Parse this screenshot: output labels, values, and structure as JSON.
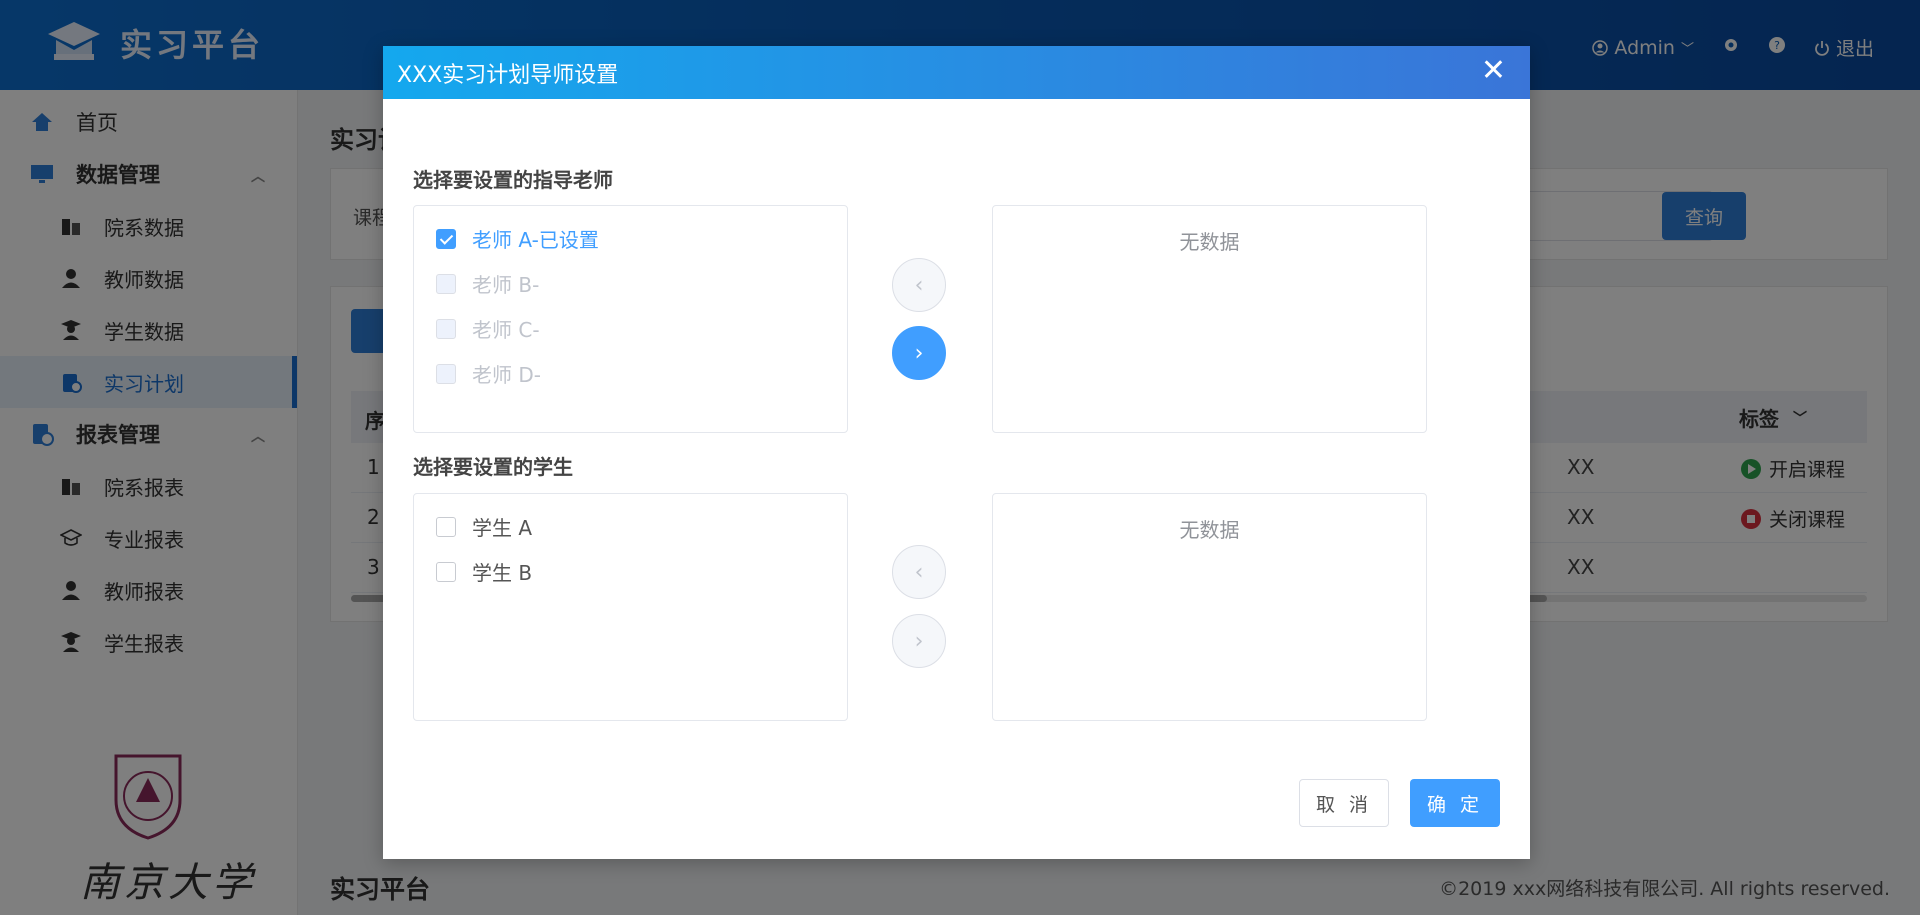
{
  "app": {
    "title": "实习平台"
  },
  "header": {
    "user": "Admin",
    "logout": "退出"
  },
  "sidebar": {
    "home": "首页",
    "groups": [
      {
        "label": "数据管理",
        "items": [
          "院系数据",
          "教师数据",
          "学生数据",
          "实习计划"
        ]
      },
      {
        "label": "报表管理",
        "items": [
          "院系报表",
          "专业报表",
          "教师报表",
          "学生报表"
        ]
      }
    ],
    "active_item": "实习计划",
    "calligraphy": "南京大学"
  },
  "main": {
    "page_title": "实习计",
    "filter_label": "课程",
    "query_button": "查询",
    "table": {
      "first_col_header": "序",
      "tag_header": "标签",
      "rows": [
        {
          "n": "1",
          "x": "XX",
          "tag": "开启课程",
          "status": "on"
        },
        {
          "n": "2",
          "x": "XX",
          "tag": "关闭课程",
          "status": "off"
        },
        {
          "n": "3",
          "x": "XX",
          "tag": "",
          "status": ""
        }
      ]
    },
    "footer_title": "实习平台",
    "copyright": "©2019 xxx网络科技有限公司. All rights reserved."
  },
  "modal": {
    "title": "XXX实习计划导师设置",
    "teacher_section": "选择要设置的指导老师",
    "teachers": [
      {
        "label": "老师 A-已设置",
        "checked": true,
        "disabled": false
      },
      {
        "label": "老师 B-",
        "checked": false,
        "disabled": true
      },
      {
        "label": "老师 C-",
        "checked": false,
        "disabled": true
      },
      {
        "label": "老师 D-",
        "checked": false,
        "disabled": true
      }
    ],
    "teacher_target_empty": "无数据",
    "student_section": "选择要设置的学生",
    "students": [
      {
        "label": "学生 A",
        "checked": false
      },
      {
        "label": "学生 B",
        "checked": false
      }
    ],
    "student_target_empty": "无数据",
    "cancel": "取 消",
    "confirm": "确 定"
  },
  "colors": {
    "primary": "#409eff",
    "header": "#0a5cb8",
    "danger": "#d9303e",
    "success": "#2ea44f"
  }
}
